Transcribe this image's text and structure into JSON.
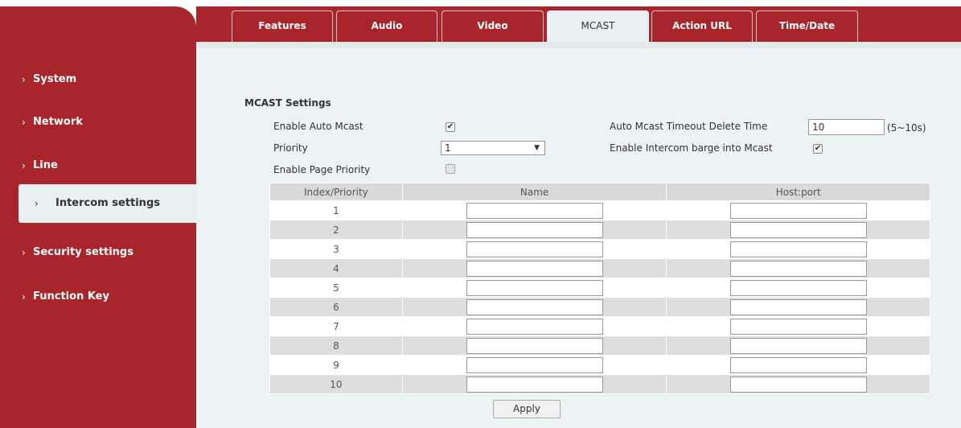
{
  "sidebar": {
    "items": [
      {
        "label": "System"
      },
      {
        "label": "Network"
      },
      {
        "label": "Line"
      },
      {
        "label": "Intercom settings"
      },
      {
        "label": "Security settings"
      },
      {
        "label": "Function Key"
      }
    ],
    "active": "Intercom settings"
  },
  "tabs": [
    {
      "label": "Features"
    },
    {
      "label": "Audio"
    },
    {
      "label": "Video"
    },
    {
      "label": "MCAST"
    },
    {
      "label": "Action URL"
    },
    {
      "label": "Time/Date"
    }
  ],
  "active_tab": "MCAST",
  "mcast": {
    "title": "MCAST Settings",
    "enable_auto_mcast_label": "Enable Auto Mcast",
    "enable_auto_mcast": true,
    "priority_label": "Priority",
    "priority_value": "1",
    "enable_page_priority_label": "Enable Page Priority",
    "enable_page_priority": false,
    "timeout_label": "Auto Mcast Timeout Delete Time",
    "timeout_value": "10",
    "timeout_range": "(5~10s)",
    "barge_label": "Enable Intercom barge into Mcast",
    "barge_enabled": true
  },
  "table": {
    "headers": [
      "Index/Priority",
      "Name",
      "Host:port"
    ],
    "rows": [
      "1",
      "2",
      "3",
      "4",
      "5",
      "6",
      "7",
      "8",
      "9",
      "10"
    ]
  },
  "apply_label": "Apply",
  "colors": {
    "brand": "#a8262b",
    "content_bg": "#ecf3f4"
  }
}
